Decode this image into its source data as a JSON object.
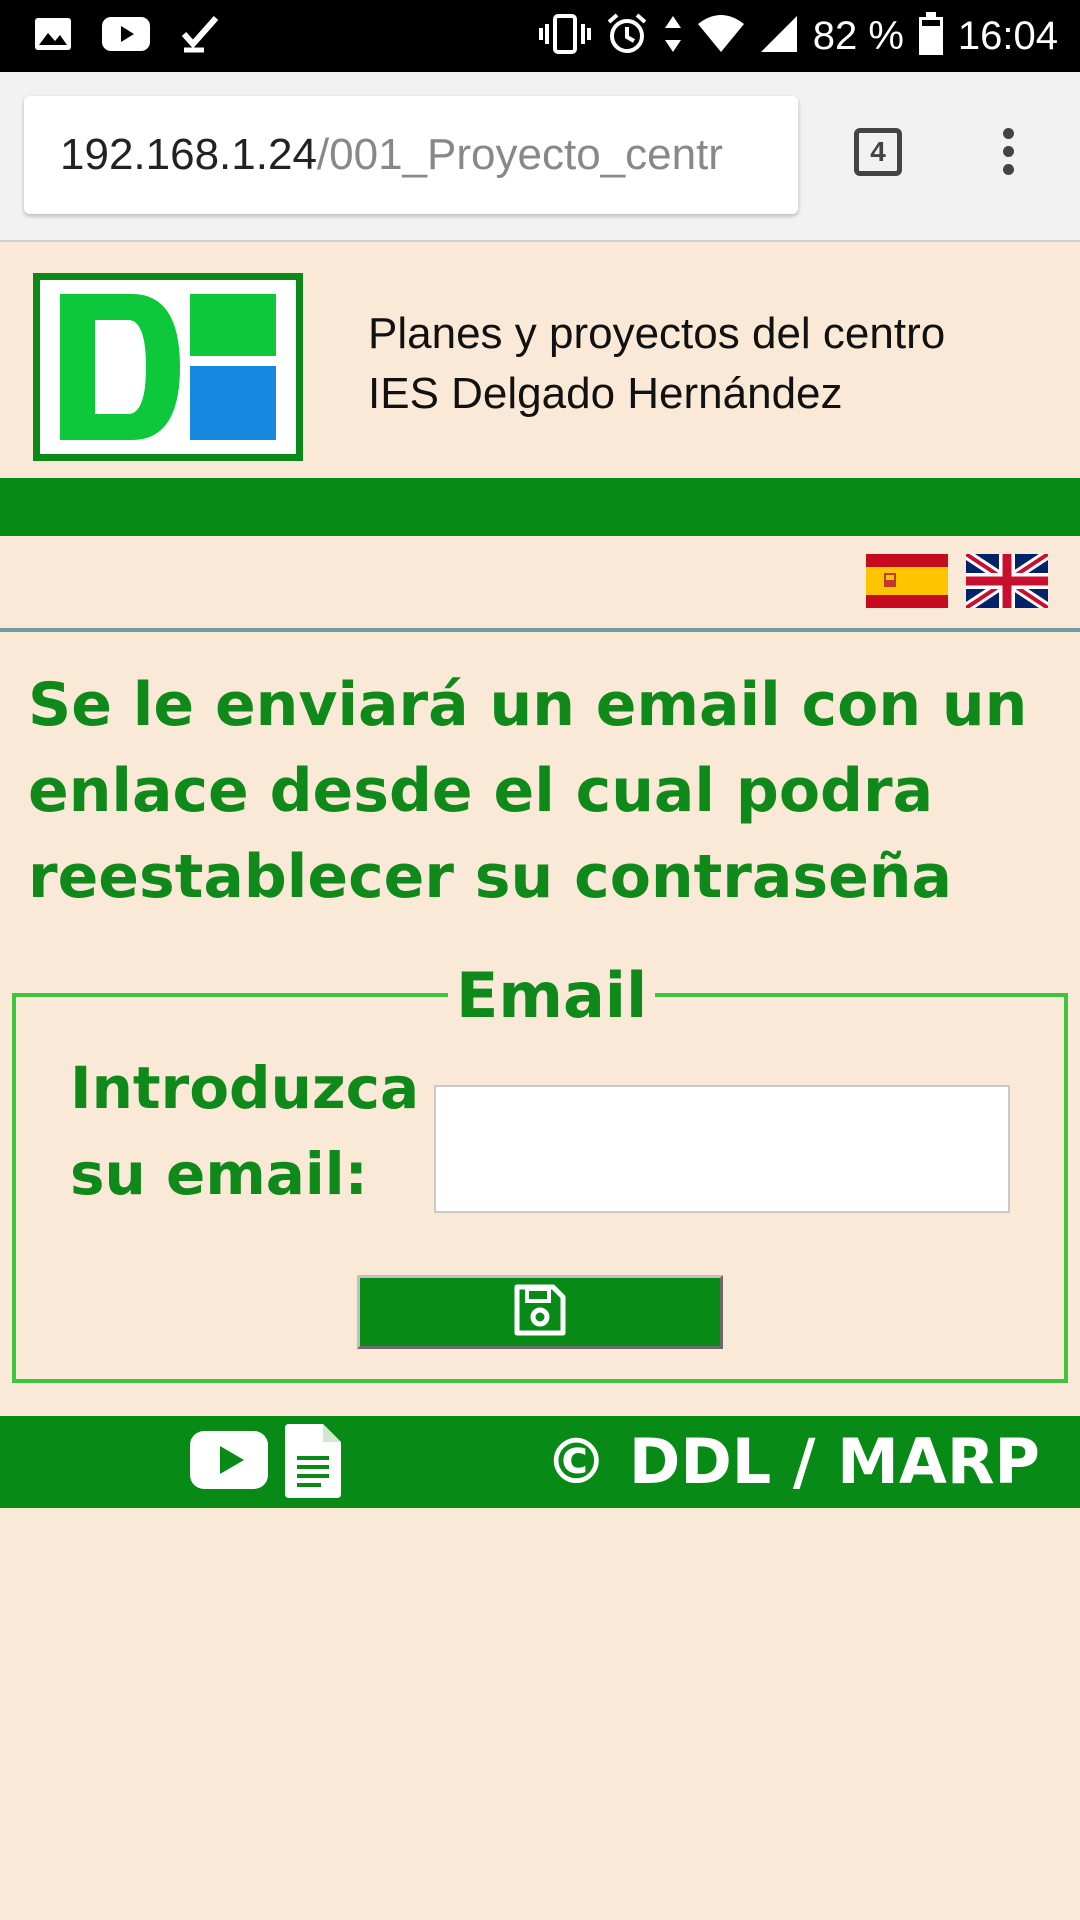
{
  "status_bar": {
    "battery": "82 %",
    "time": "16:04",
    "left_icons": [
      "image-icon",
      "youtube-icon",
      "task-check-icon"
    ],
    "right_icons": [
      "vibrate-icon",
      "alarm-icon",
      "data-arrows-icon",
      "wifi-icon",
      "signal-icon",
      "battery-icon"
    ]
  },
  "browser": {
    "url_host": "192.168.1.24",
    "url_path": "/001_Proyecto_centr",
    "tab_count": "4"
  },
  "header": {
    "title_line1": "Planes y proyectos del centro",
    "title_line2": "IES Delgado Hernández",
    "logo_text": "DH"
  },
  "languages": [
    "es-flag-icon",
    "uk-flag-icon"
  ],
  "main": {
    "message": "Se le enviará un email con un enlace desde el cual podra reestablecer su contraseña",
    "legend": "Email",
    "field_label": "Introduzca su email:",
    "email_value": "",
    "save_icon": "floppy-disk-icon"
  },
  "footer": {
    "copyright": "© DDL / MARP",
    "icons": [
      "youtube-icon",
      "document-icon"
    ]
  },
  "colors": {
    "page_bg": "#f9e9d6",
    "brand_green": "#078a16",
    "text_green": "#10891b",
    "fieldset_border": "#3cc63c"
  }
}
